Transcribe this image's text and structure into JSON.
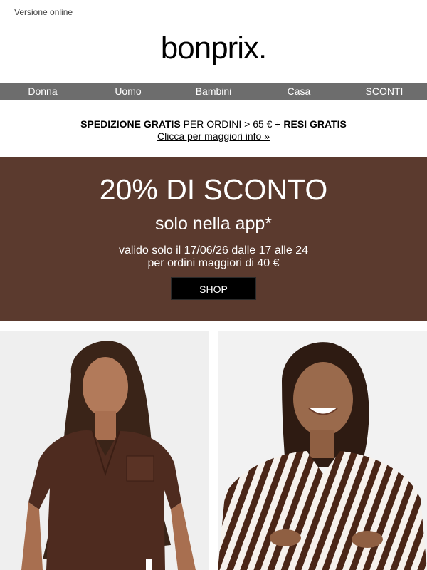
{
  "header": {
    "online_link": "Versione online",
    "logo_text": "bonprix."
  },
  "nav": {
    "items": [
      "Donna",
      "Uomo",
      "Bambini",
      "Casa",
      "SCONTI"
    ]
  },
  "shipping": {
    "bold1": "SPEDIZIONE GRATIS",
    "normal": " PER ORDINI > 65 € + ",
    "bold2": "RESI GRATIS",
    "link": "Clicca per maggiori info »"
  },
  "banner": {
    "title": "20% DI SCONTO",
    "subtitle": "solo nella app*",
    "validity": "valido solo il 17/06/26 dalle 17 alle 24",
    "minimum": "per ordini maggiori di 40 €",
    "cta": "SHOP",
    "bg_color": "#5b3a2e"
  },
  "images": {
    "left": "woman-brown-top-photo",
    "right": "woman-striped-shirt-photo"
  }
}
